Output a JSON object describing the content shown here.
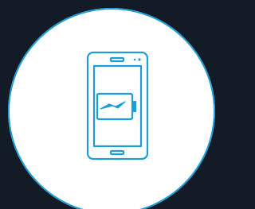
{
  "scene": {
    "background_color": "#131c26",
    "badge_color": "#ffffff",
    "accent_color": "#1e9ed8",
    "icons": [
      "smartphone-icon",
      "charging-battery-icon",
      "lightning-bolt-icon"
    ]
  }
}
